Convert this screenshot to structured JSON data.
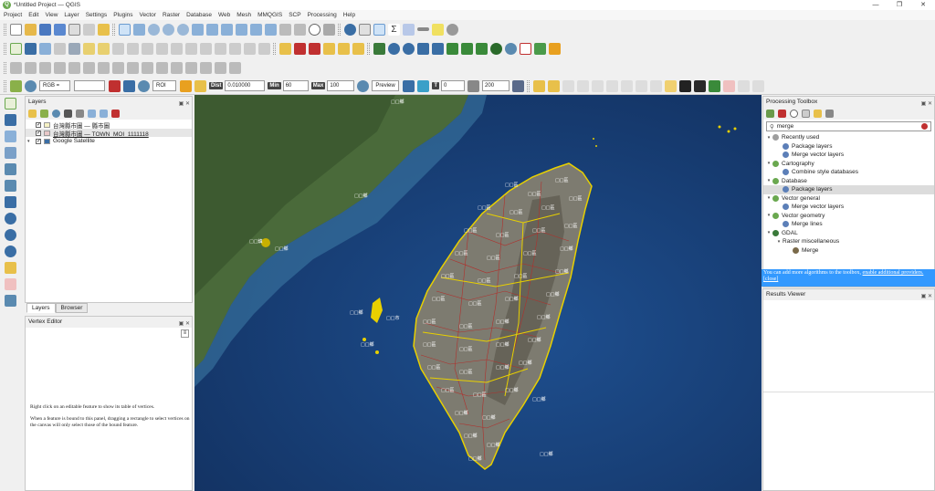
{
  "window": {
    "title": "*Untitled Project — QGIS"
  },
  "menu": [
    "Project",
    "Edit",
    "View",
    "Layer",
    "Settings",
    "Plugins",
    "Vector",
    "Raster",
    "Database",
    "Web",
    "Mesh",
    "MMQGIS",
    "SCP",
    "Processing",
    "Help"
  ],
  "scp": {
    "rgb_label": "RGB =",
    "roi_label": "ROI",
    "preview_label": "Preview",
    "dist_label": "Dist",
    "dist_value": "0.010000",
    "min_label": "Min",
    "min_value": "60",
    "max_label": "Max",
    "max_value": "100",
    "t_label": "T",
    "t_value": "0",
    "count_value": "200"
  },
  "layers_panel": {
    "title": "Layers",
    "items": [
      {
        "label": "台灣縣市圖 — 縣市圖",
        "checked": "✓",
        "swatch": "#f6f2c4"
      },
      {
        "label": "台灣縣市圖 — TOWN_MOI_1111118",
        "checked": "✓",
        "swatch": "#e8c8c8"
      },
      {
        "label": "Google Satellite",
        "checked": "✓",
        "swatch": "#3a6ea5"
      }
    ],
    "tabs": [
      "Layers",
      "Browser"
    ]
  },
  "vertex_editor": {
    "title": "Vertex Editor",
    "text1": "Right click on an editable feature to show its table of vertices.",
    "text2": "When a feature is bound to this panel, dragging a rectangle to select vertices on the canvas will only select those of the bound feature."
  },
  "processing": {
    "title": "Processing Toolbox",
    "search": "merge",
    "tree": [
      {
        "label": "Recently used",
        "level": 0,
        "group": true,
        "color": "#9e9e9e"
      },
      {
        "label": "Package layers",
        "level": 1,
        "color": "#5c7fb8"
      },
      {
        "label": "Merge vector layers",
        "level": 1,
        "color": "#5c7fb8"
      },
      {
        "label": "Cartography",
        "level": 0,
        "group": true,
        "color": "#6aa84f"
      },
      {
        "label": "Combine style databases",
        "level": 1,
        "color": "#5c7fb8"
      },
      {
        "label": "Database",
        "level": 0,
        "group": true,
        "color": "#6aa84f"
      },
      {
        "label": "Package layers",
        "level": 1,
        "color": "#5c7fb8",
        "selected": true
      },
      {
        "label": "Vector general",
        "level": 0,
        "group": true,
        "color": "#6aa84f"
      },
      {
        "label": "Merge vector layers",
        "level": 1,
        "color": "#5c7fb8"
      },
      {
        "label": "Vector geometry",
        "level": 0,
        "group": true,
        "color": "#6aa84f"
      },
      {
        "label": "Merge lines",
        "level": 1,
        "color": "#5c7fb8"
      },
      {
        "label": "GDAL",
        "level": 0,
        "group": true,
        "color": "#3a7a3a"
      },
      {
        "label": "Raster miscellaneous",
        "level": 1,
        "group": true,
        "color": ""
      },
      {
        "label": "Merge",
        "level": 2,
        "color": "#7a6a4a"
      }
    ],
    "info_text": "You can add more algorithms to the toolbox,",
    "info_link": "enable additional providers.",
    "info_close": "[close]"
  },
  "results_viewer": {
    "title": "Results Viewer"
  },
  "colors": {
    "ocean": "#183e7a",
    "boundary": "#e8d000",
    "town": "#b0302c",
    "accent": "#3399ff"
  }
}
